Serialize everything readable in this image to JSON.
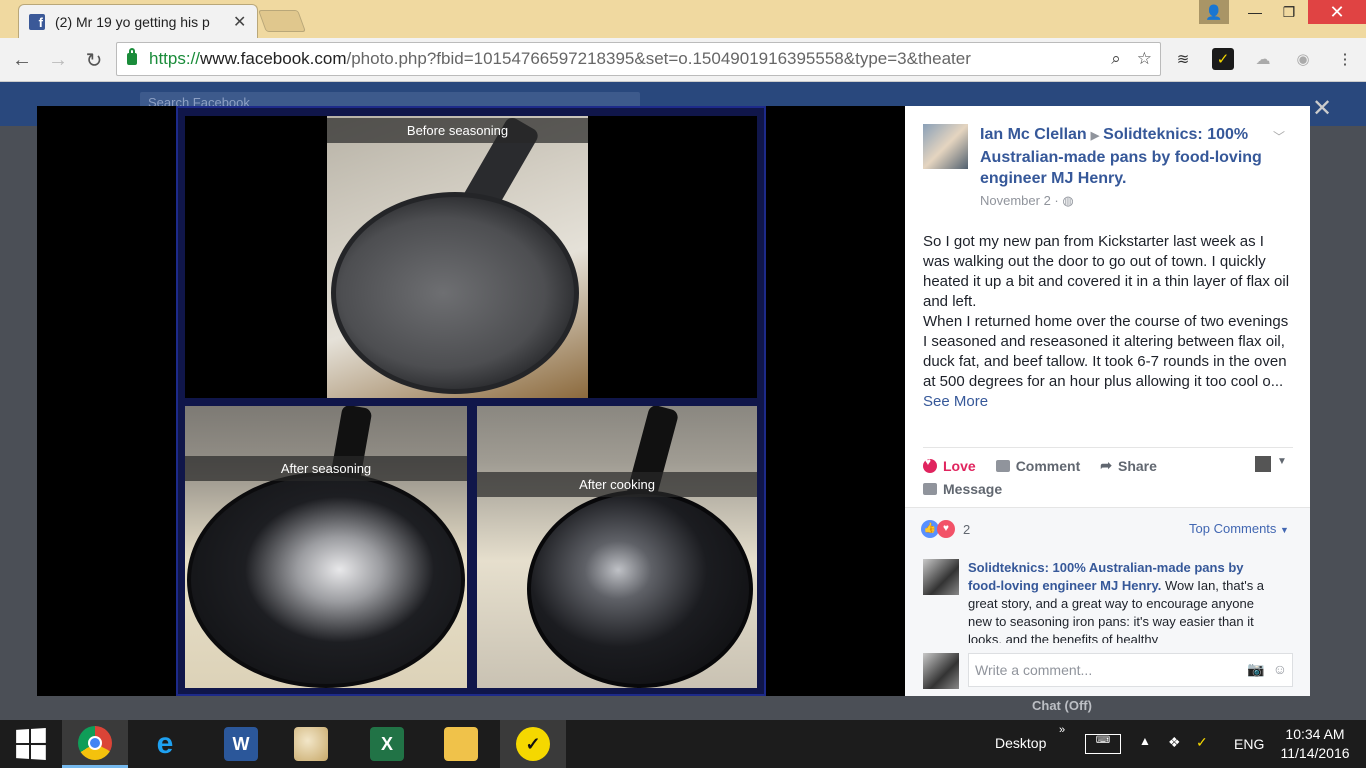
{
  "browser": {
    "tab_title": "(2) Mr 19 yo getting his p",
    "tab_close": "✕",
    "url_proto": "https://",
    "url_host": "www.facebook.com",
    "url_path": "/photo.php?fbid=10154766597218395&set=o.1504901916395558&type=3&theater"
  },
  "background_page": {
    "search_placeholder": "Search Facebook"
  },
  "photo": {
    "caption_top": "Before seasoning",
    "caption_bottom_left": "After seasoning",
    "caption_bottom_right": "After cooking"
  },
  "post": {
    "author": "Ian Mc Clellan",
    "target_group": "Solidteknics: 100% Australian-made pans by food-loving engineer MJ Henry.",
    "date": "November 2",
    "text_line1": "So I got my new pan from Kickstarter last week as I was walking out the door to go out of town. I quickly heated it up a bit and covered it in a thin layer of flax oil and left.",
    "text_line2": "When I returned home over the course of two evenings I seasoned and reseasoned it altering between flax oil, duck fat, and beef tallow. It took 6-7 rounds in the oven at 500 degrees for an hour plus allowing it too cool o...",
    "see_more": "See More"
  },
  "actions": {
    "love": "Love",
    "comment": "Comment",
    "share": "Share",
    "message": "Message"
  },
  "reactions": {
    "count": "2",
    "sort_label": "Top Comments"
  },
  "comment": {
    "name": "Solidteknics: 100% Australian-made pans by food-loving engineer MJ Henry.",
    "text": "Wow Ian, that's a great story, and a great way to encourage anyone new to seasoning iron pans: it's way easier than it looks, and the benefits of healthy"
  },
  "write_comment": {
    "placeholder": "Write a comment..."
  },
  "chat": {
    "label": "Chat (Off)"
  },
  "taskbar": {
    "desktop_label": "Desktop",
    "language": "ENG",
    "time": "10:34 AM",
    "date": "11/14/2016"
  }
}
